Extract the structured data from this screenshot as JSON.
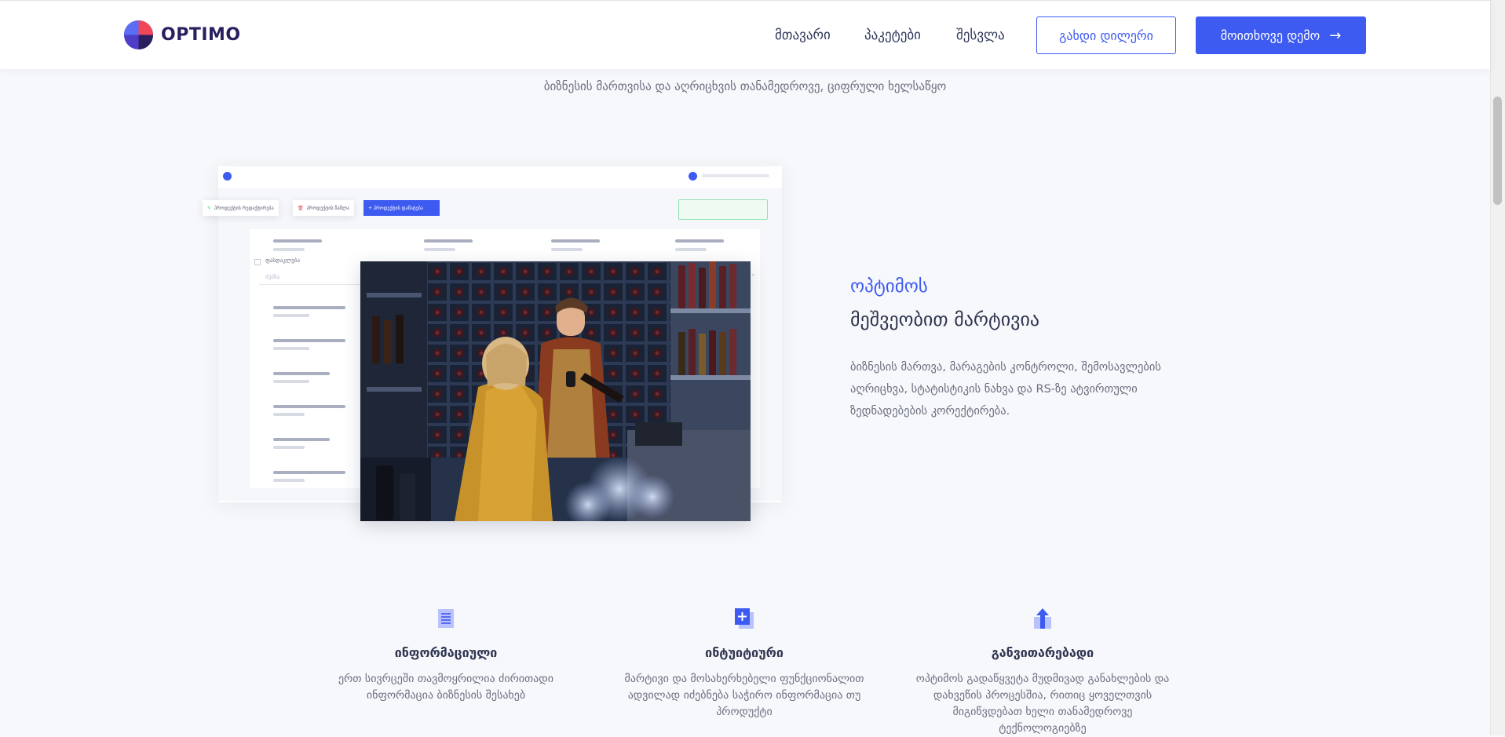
{
  "brand": {
    "name": "OPTIMO"
  },
  "nav": {
    "links": [
      "მთავარი",
      "პაკეტები",
      "შესვლა"
    ],
    "dealer_button": "გახდი დილერი",
    "demo_button": "მოითხოვე დემო",
    "demo_arrow": "→"
  },
  "hero": {
    "tagline": "ბიზნესის მართვისა და აღრიცხვის თანამედროვე, ციფრული ხელსაწყო"
  },
  "mockup": {
    "chips": [
      "პროდუქტის რედაქტირება",
      "პროდუქტის წაშლა",
      "+ პროდუქტის დამატება"
    ],
    "filter_label": "ფასდაკლება",
    "search_placeholder": "ძებნა"
  },
  "feature_section": {
    "eyebrow": "ოპტიმოს",
    "heading": "მეშვეობით მარტივია",
    "paragraph": "ბიზნესის მართვა, მარაგების კონტროლი, შემოსავლების აღრიცხვა, სტატისტიკის ნახვა და RS-ზე ატვირთული ზედნადებების კორექტირება."
  },
  "features": [
    {
      "icon": "document-icon",
      "title": "ინფორმაციული",
      "text": "ერთ სივრცეში თავმოყრილია ძირითადი ინფორმაცია ბიზნესის შესახებ"
    },
    {
      "icon": "add-document-icon",
      "title": "ინტუიტიური",
      "text": "მარტივი და მოსახერხებელი ფუნქციონალით ადვილად იძებნება საჭირო ინფორმაცია თუ პროდუქტი"
    },
    {
      "icon": "arrow-up-icon",
      "title": "განვითარებადი",
      "text": "ოპტიმოს გადაწყვეტა მუდმივად განახლების და დახვეწის პროცესშია, რითიც ყოველთვის მიგიწვდებათ ხელი თანამედროვე ტექნოლოგიებზე"
    }
  ],
  "colors": {
    "accent": "#3d5af1",
    "brand_red": "#f0465a",
    "brand_dark": "#2a2060"
  }
}
